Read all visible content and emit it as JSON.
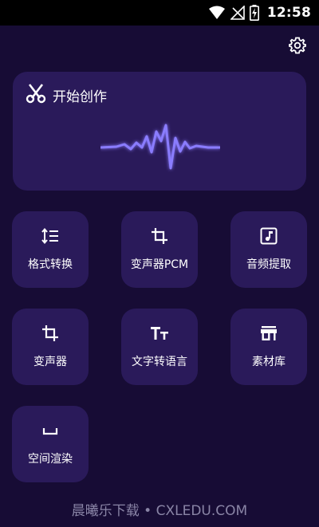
{
  "status_bar": {
    "time": "12:58",
    "icons": [
      "wifi-icon",
      "no-signal-icon",
      "battery-charging-icon"
    ]
  },
  "header": {
    "settings_icon": "gear-icon"
  },
  "hero": {
    "title": "开始创作",
    "icon": "scissors-icon",
    "wave_icon": "waveform-icon"
  },
  "tools": [
    {
      "label": "格式转换",
      "icon": "format-list-icon"
    },
    {
      "label": "变声器PCM",
      "icon": "crop-icon"
    },
    {
      "label": "音频提取",
      "icon": "music-note-icon"
    },
    {
      "label": "变声器",
      "icon": "crop-icon"
    },
    {
      "label": "文字转语言",
      "icon": "text-size-icon"
    },
    {
      "label": "素材库",
      "icon": "store-icon"
    },
    {
      "label": "空间渲染",
      "icon": "space-bar-icon"
    }
  ],
  "watermark": "晨曦乐下载 • CXLEDU.COM",
  "colors": {
    "background": "#170c35",
    "card": "#2a1a5a",
    "wave": "#8a7cff"
  }
}
